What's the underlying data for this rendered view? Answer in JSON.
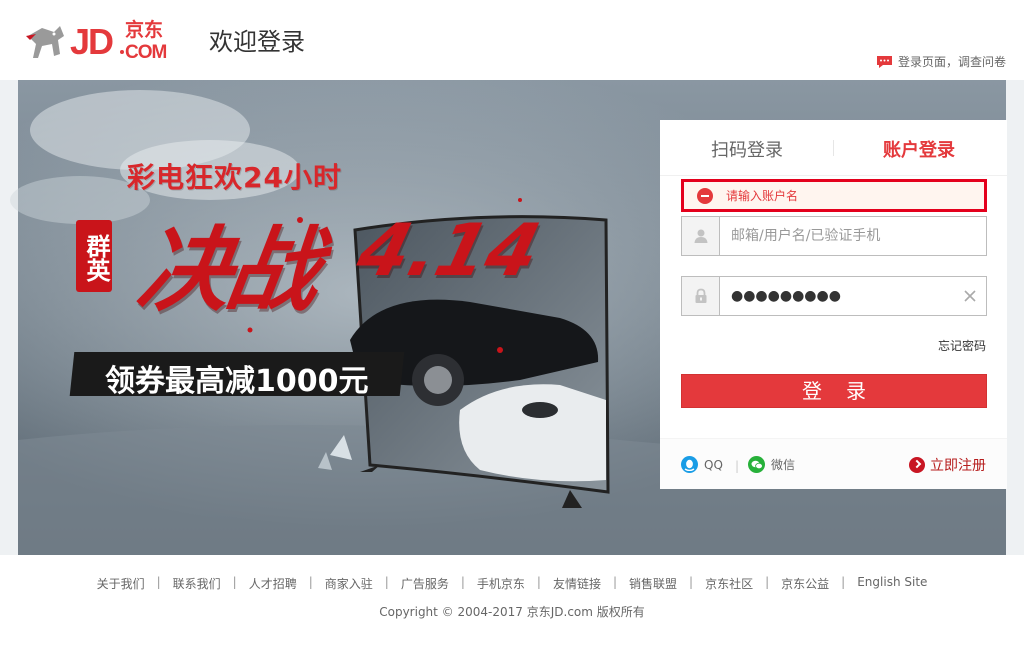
{
  "header": {
    "logo_text": "JD.COM",
    "logo_cn": "京东",
    "welcome": "欢迎登录",
    "feedback": "登录页面，调查问卷"
  },
  "banner": {
    "promo_sub": "彩电狂欢24小时",
    "badge": "群英",
    "promo_main": "决战",
    "promo_date": "4.14",
    "coupon": "领券最高减1000元"
  },
  "login": {
    "tab_qr": "扫码登录",
    "tab_account": "账户登录",
    "error_message": "请输入账户名",
    "username_placeholder": "邮箱/用户名/已验证手机",
    "username_value": "",
    "password_value": "●●●●●●●●●",
    "forgot": "忘记密码",
    "submit": "登录",
    "qq": "QQ",
    "social_sep": "|",
    "wechat": "微信",
    "register": "立即注册",
    "colors": {
      "accent": "#e4393c",
      "error_border": "#e4001c"
    }
  },
  "footer": {
    "links": [
      "关于我们",
      "联系我们",
      "人才招聘",
      "商家入驻",
      "广告服务",
      "手机京东",
      "友情链接",
      "销售联盟",
      "京东社区",
      "京东公益",
      "English Site"
    ],
    "separator": "|",
    "copyright": "Copyright © 2004-2017  京东JD.com 版权所有"
  }
}
